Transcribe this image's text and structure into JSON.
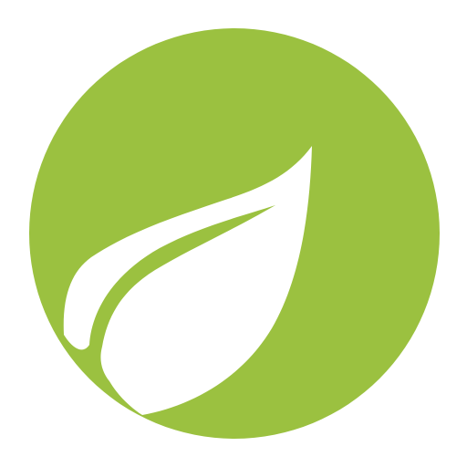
{
  "app_icon": {
    "icon": "leaf-icon",
    "shape": "circle",
    "colors": {
      "background": "#ffffff",
      "circle": "#9bc140",
      "leaf": "#ffffff"
    }
  }
}
